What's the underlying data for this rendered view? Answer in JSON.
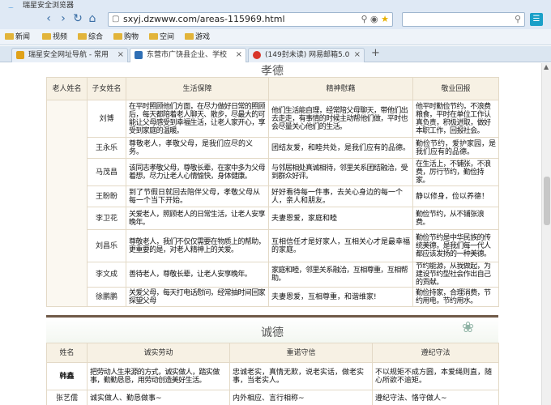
{
  "browser": {
    "title": "瑞星安全浏览器",
    "url": "sxyj.dzwww.com/areas-115969.html",
    "bookmarks": [
      "新闻",
      "视频",
      "综合",
      "购物",
      "空间",
      "游戏"
    ],
    "tabs": [
      {
        "label": "瑞星安全网址导航 - 常用",
        "active": false
      },
      {
        "label": "东营市广饶县企业、学校",
        "active": true
      },
      {
        "label": "(149封未读) 网易邮箱5.0",
        "active": false
      }
    ]
  },
  "section1": {
    "title": "孝德",
    "headers": [
      "老人姓名",
      "子女姓名",
      "生活保障",
      "精神慰藉",
      "敬业回报"
    ],
    "rows": [
      {
        "child": "刘博",
        "life": "在平时照顾他们方面，在尽力做好日常的照顾后，每天都陪着老人聊天、散步，尽最大的可能让父母感受到幸福生活，让老人家开心，享受到家庭的温暖。",
        "spirit": "他们生活能自理，经常陪父母聊天，带他们出去走走，有事情的时候主动帮他们做，平时也会尽量关心他们的生活。",
        "work": "他平时勤俭节约，不浪费粮食，平时在单位工作认真负责，积极进取，做好本职工作，回报社会。"
      },
      {
        "child": "王永乐",
        "life": "尊敬老人，孝敬父母，是我们应尽的义务。",
        "spirit": "团结友爱，和睦共处，是我们应有的品德。",
        "work": "勤俭节约，爱护家园，是我们应有的品德。"
      },
      {
        "child": "马茂昌",
        "life": "该同志孝敬父母，尊敬长辈，在家中多为父母着想，尽力让老人心情愉快，身体健康。",
        "spirit": "与邻居相处真诚相待，邻里关系团结融洽，受到群众好评。",
        "work": "在生活上，不铺张，不浪费，厉行节约，勤俭持家。"
      },
      {
        "child": "王盼盼",
        "life": "到了节假日就回去陪伴父母，孝敬父母从每一个当下开始。",
        "spirit": "好好看待每一件事，去关心身边的每一个人，亲人和朋友。",
        "work": "静以修身，俭以养德！"
      },
      {
        "child": "李卫花",
        "life": "关爱老人，照顾老人的日常生活，让老人安享晚年。",
        "spirit": "夫妻恩爱，家庭和睦",
        "work": "勤俭节约，从不铺张浪费。"
      },
      {
        "child": "刘昌乐",
        "life": "尊敬老人，我们不仅仅需要在物质上的帮助，更重要的是，对老人精神上的关爱。",
        "spirit": "互相信任才是好家人，互相关心才是最幸福的家庭。",
        "work": "勤俭节约是中华民族的传统美德，是我们每一代人都应该发扬的一种美德。"
      },
      {
        "child": "李文成",
        "life": "善待老人，尊敬长辈，让老人安享晚年。",
        "spirit": "家庭和睦，邻里关系融洽，互相尊重，互相帮助。",
        "work": "节约能源，从我做起，为建设节约型社会作出自己的贡献。"
      },
      {
        "child": "徐鹏鹏",
        "life": "关爱父母，每天打电话慰问，经常抽时间回家探望父母",
        "spirit": "夫妻恩爱，互相尊重，和谐维家!",
        "work": "勤俭持家，合理消费，节约用电，节约用水。"
      }
    ]
  },
  "section2": {
    "title": "诚德",
    "headers": [
      "姓名",
      "诚实劳动",
      "重诺守信",
      "遵纪守法"
    ],
    "rows": [
      {
        "name": "韩鑫",
        "labor": "把劳动人生来源的方式，诚实做人，踏实做事，勤勤恳恳，用劳动创造美好生活。",
        "promise": "忠诚老实，真情无欺，说老实话，做老实事，当老实人。",
        "law": "不以规矩不成方圆，本爱绳则直，随心所欲不逾矩。"
      },
      {
        "name": "张艺儒",
        "labor": "诚实做人、勤恳做事~",
        "promise": "内外相应、言行相称~",
        "law": "遵纪守法、恪守做人~"
      }
    ]
  }
}
